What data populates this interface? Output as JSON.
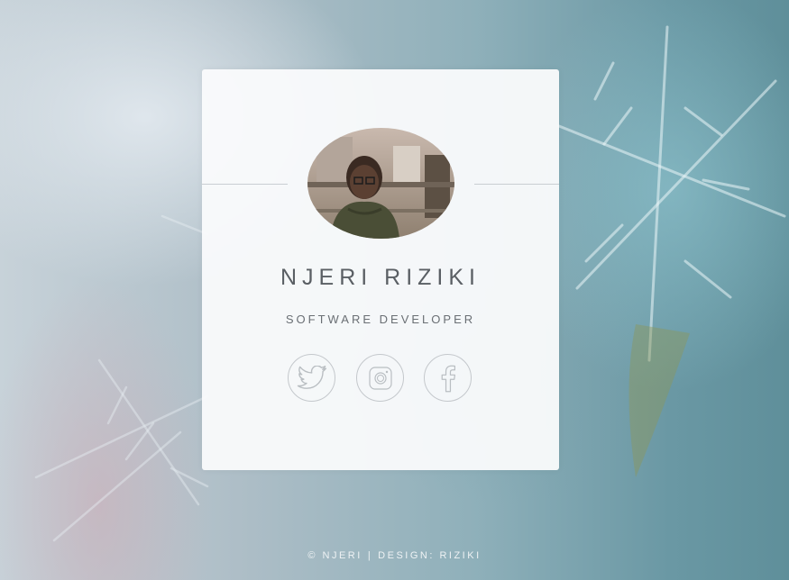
{
  "profile": {
    "name": "NJERI RIZIKI",
    "title": "SOFTWARE DEVELOPER"
  },
  "social": [
    {
      "id": "twitter",
      "icon": "twitter-icon"
    },
    {
      "id": "instagram",
      "icon": "instagram-icon"
    },
    {
      "id": "facebook",
      "icon": "facebook-icon"
    }
  ],
  "footer": {
    "copyright": "© NJERI",
    "design": "DESIGN: RIZIKI"
  }
}
